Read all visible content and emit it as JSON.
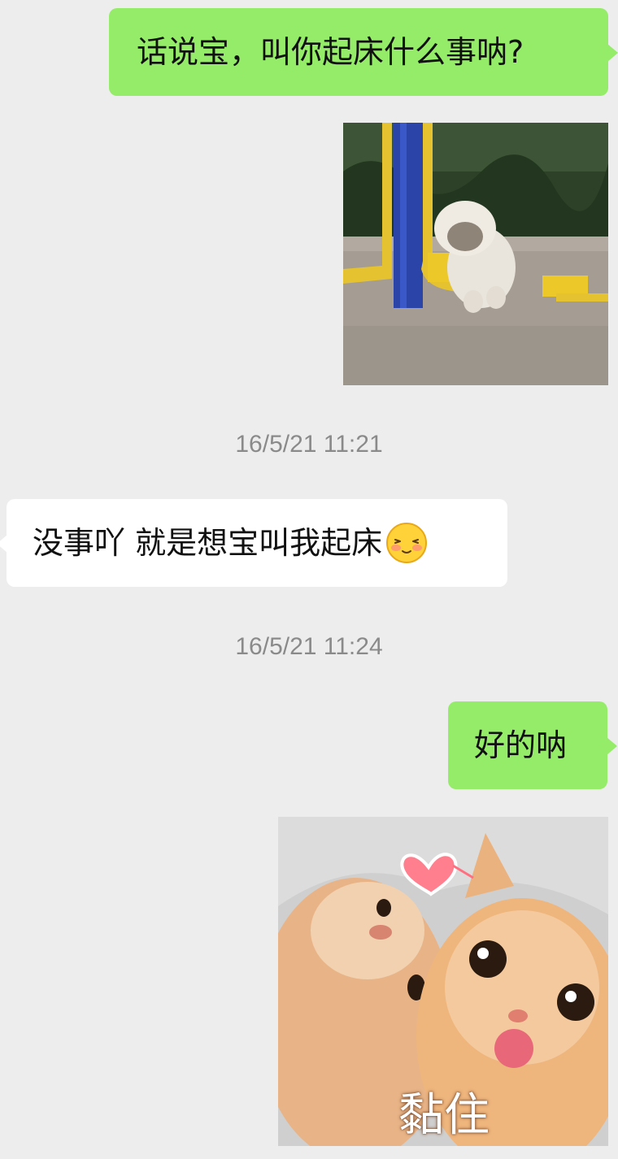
{
  "messages": {
    "m1": {
      "text": "话说宝，叫你起床什么事呐?"
    },
    "m2": {
      "image_desc_icon": "puppy-image"
    },
    "ts1": {
      "text": "16/5/21 11:21"
    },
    "m3": {
      "text": "没事吖 就是想宝叫我起床",
      "emoji": "blush-emoji"
    },
    "ts2": {
      "text": "16/5/21 11:24"
    },
    "m4": {
      "text": "好的呐"
    },
    "m5": {
      "caption": "黏住",
      "image_desc_icon": "cats-sticker"
    }
  },
  "colors": {
    "background": "#ededed",
    "outgoing_bubble": "#95ec69",
    "incoming_bubble": "#ffffff",
    "timestamp": "#8a8a8a"
  }
}
